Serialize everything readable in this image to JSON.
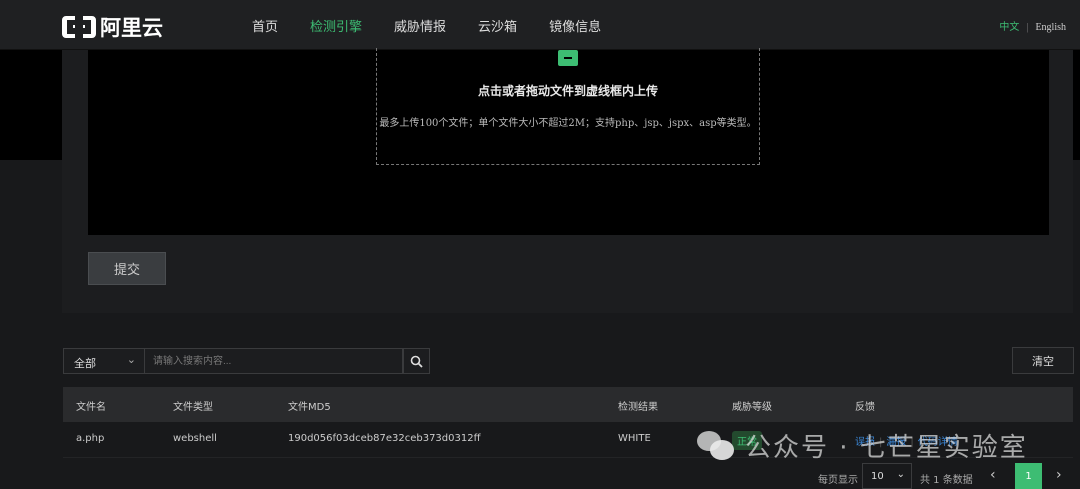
{
  "header": {
    "logo": "阿里云",
    "nav": [
      "首页",
      "检测引擎",
      "威胁情报",
      "云沙箱",
      "镜像信息"
    ],
    "active_nav": 1,
    "lang_zh": "中文",
    "lang_sep": "|",
    "lang_en": "English"
  },
  "upload": {
    "title": "点击或者拖动文件到虚线框内上传",
    "hint": "最多上传100个文件；单个文件大小不超过2M；支持php、jsp、jspx、asp等类型。",
    "submit": "提交"
  },
  "search": {
    "select_value": "全部",
    "placeholder": "请输入搜索内容...",
    "clear": "清空"
  },
  "table": {
    "headers": [
      "文件名",
      "文件类型",
      "文件MD5",
      "检测结果",
      "威胁等级",
      "反馈"
    ],
    "rows": [
      {
        "name": "a.php",
        "type": "webshell",
        "md5": "190d056f03dceb87e32ceb373d0312ff",
        "result": "WHITE",
        "level": "正常",
        "feedback": [
          "误报",
          "漏报",
          "代码详情"
        ]
      }
    ]
  },
  "pagination": {
    "per_page_label": "每页显示",
    "per_page": "10",
    "total": "共 1 条数据",
    "current": "1"
  },
  "watermark": "公众号 · 七芒星实验室",
  "colors": {
    "accent": "#3dbd73",
    "link": "#3a86d6"
  }
}
